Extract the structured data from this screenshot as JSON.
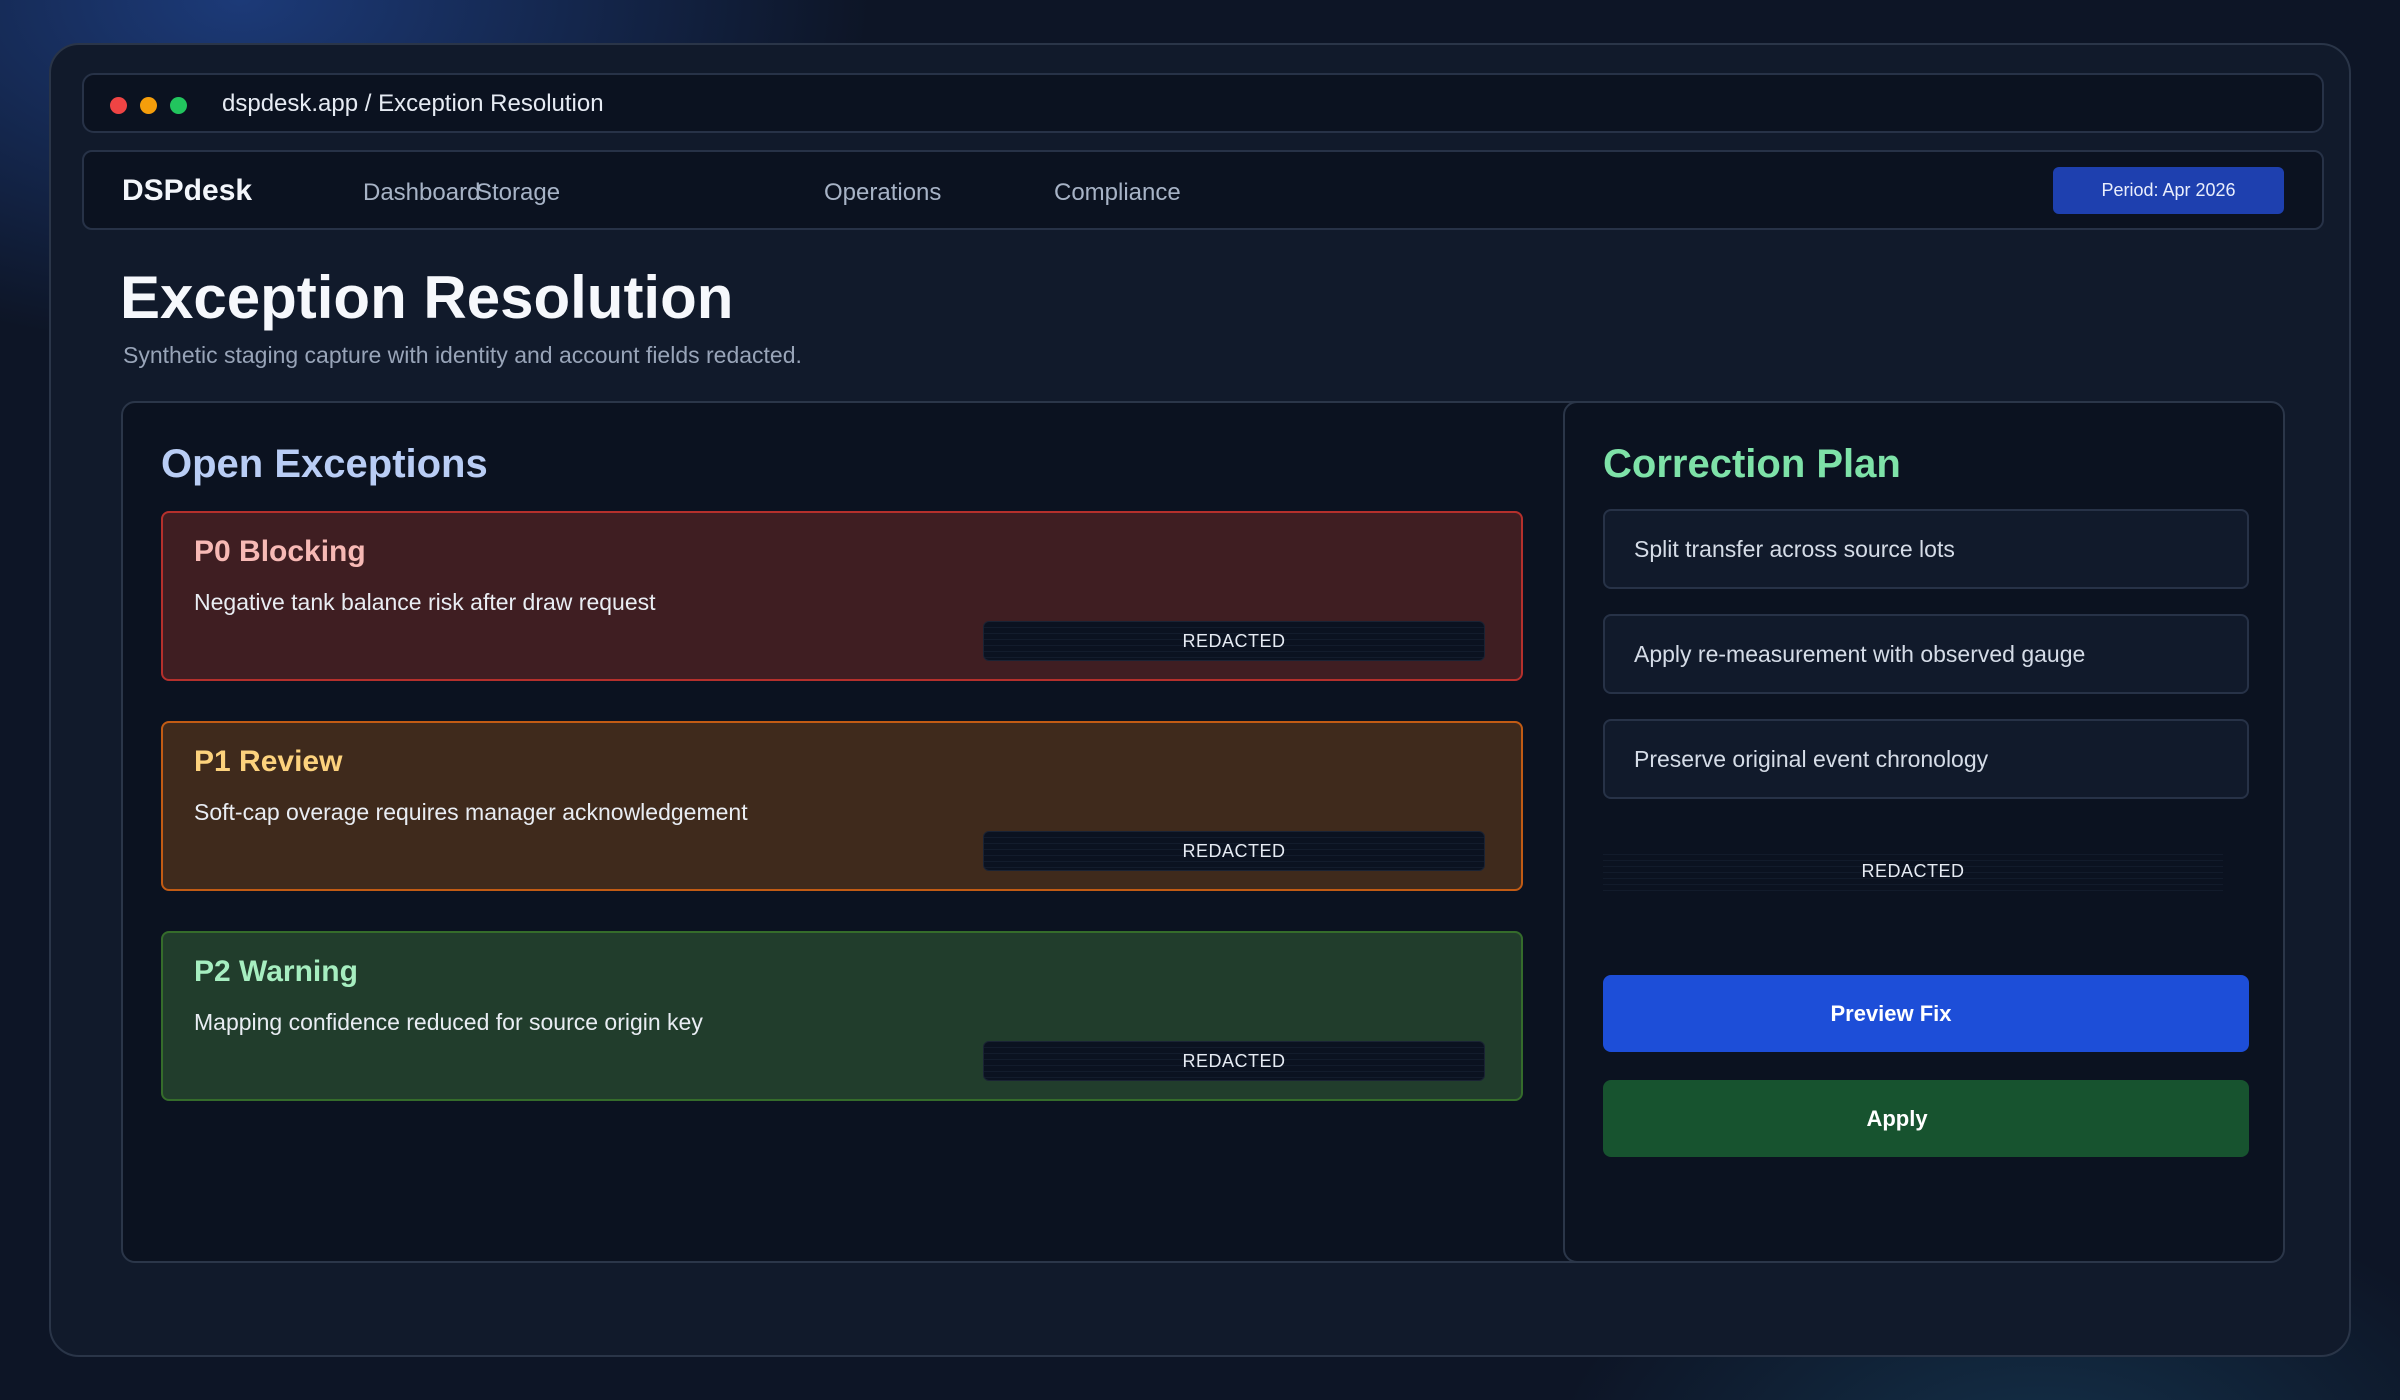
{
  "window": {
    "url": "dspdesk.app / Exception Resolution"
  },
  "nav": {
    "brand": "DSPdesk",
    "links": [
      "Dashboard",
      "Storage",
      "Operations",
      "Compliance"
    ],
    "period": "Period: Apr 2026"
  },
  "page": {
    "title": "Exception Resolution",
    "subtitle": "Synthetic staging capture with identity and account fields redacted."
  },
  "exceptions": {
    "title": "Open Exceptions",
    "items": [
      {
        "severity": "P0 Blocking",
        "description": "Negative tank balance risk after draw request",
        "redacted": "REDACTED",
        "color": "#b5302c"
      },
      {
        "severity": "P1 Review",
        "description": "Soft-cap overage requires manager acknowledgement",
        "redacted": "REDACTED",
        "color": "#c25b14"
      },
      {
        "severity": "P2 Warning",
        "description": "Mapping confidence reduced for source origin key",
        "redacted": "REDACTED",
        "color": "#356c2b"
      }
    ]
  },
  "plan": {
    "title": "Correction Plan",
    "steps": [
      "Split transfer across source lots",
      "Apply re-measurement with observed gauge",
      "Preserve original event chronology"
    ],
    "redacted": "REDACTED",
    "preview_label": "Preview Fix",
    "apply_label": "Apply"
  },
  "colors": {
    "accent_blue": "#1d4ed8",
    "apply_green": "#17532f",
    "plan_title": "#7ee2a8",
    "exceptions_title": "#b9cdf5"
  }
}
